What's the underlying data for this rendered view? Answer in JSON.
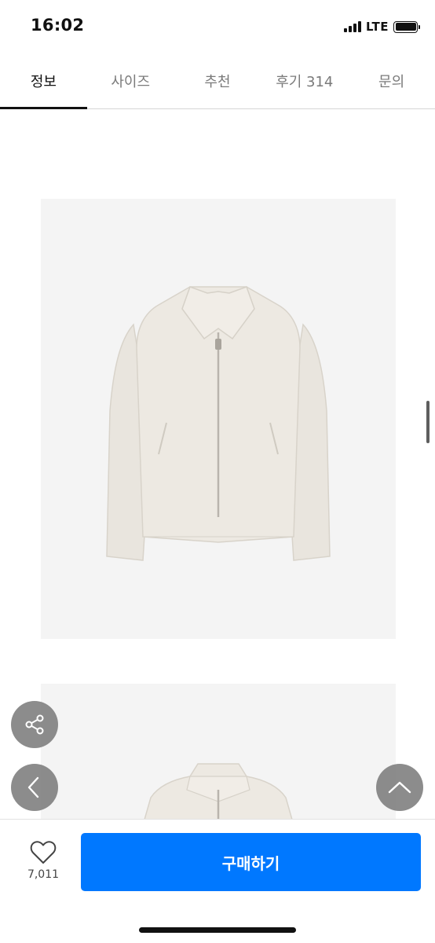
{
  "status": {
    "time": "16:02",
    "network": "LTE",
    "battery_level": 1.0
  },
  "tabs": [
    {
      "label": "정보",
      "active": true
    },
    {
      "label": "사이즈",
      "active": false
    },
    {
      "label": "추천",
      "active": false
    },
    {
      "label": "후기 314",
      "active": false
    },
    {
      "label": "문의",
      "active": false
    }
  ],
  "product": {
    "images": [
      {
        "subject": "ivory cropped zip-up jacket, front view"
      },
      {
        "subject": "ivory cropped zip-up jacket, partial view"
      }
    ],
    "colors": {
      "jacket": "#ebe7e0",
      "image_bg": "#f4f4f4"
    }
  },
  "floating": {
    "share_icon": "share-icon",
    "back_icon": "chevron-left-icon",
    "top_icon": "chevron-up-icon"
  },
  "bottom_bar": {
    "like_icon": "heart-icon",
    "like_count": "7,011",
    "buy_label": "구매하기",
    "buy_color": "#0078ff"
  }
}
